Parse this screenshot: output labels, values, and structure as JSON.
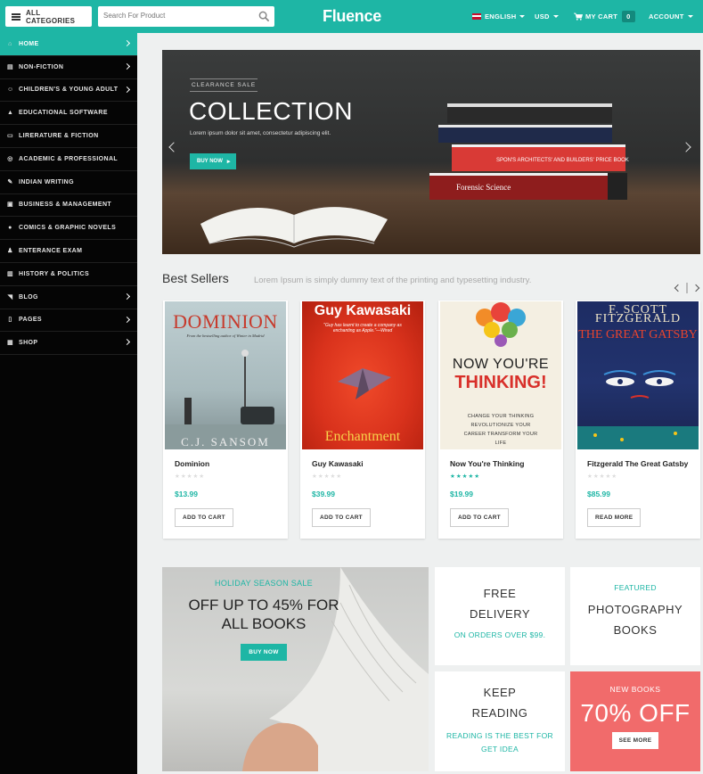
{
  "header": {
    "all_categories": "ALL CATEGORIES",
    "search_placeholder": "Search For Product",
    "logo": "Fluence",
    "language": "ENGLISH",
    "currency": "USD",
    "cart_label": "MY CART",
    "cart_count": "0",
    "account": "ACCOUNT"
  },
  "sidebar": {
    "items": [
      {
        "label": "HOME",
        "icon": "home-icon"
      },
      {
        "label": "NON-FICTION",
        "icon": "book-icon"
      },
      {
        "label": "CHILDREN'S & YOUNG ADULT",
        "icon": "child-icon"
      },
      {
        "label": "EDUCATIONAL SOFTWARE",
        "icon": "mortarboard-icon"
      },
      {
        "label": "LIRERATURE & FICTION",
        "icon": "book-open-icon"
      },
      {
        "label": "ACADEMIC & PROFESSIONAL",
        "icon": "target-icon"
      },
      {
        "label": "INDIAN WRITING",
        "icon": "pen-icon"
      },
      {
        "label": "BUSINESS & MANAGEMENT",
        "icon": "briefcase-icon"
      },
      {
        "label": "COMICS & GRAPHIC NOVELS",
        "icon": "chat-icon"
      },
      {
        "label": "ENTERANCE EXAM",
        "icon": "user-icon"
      },
      {
        "label": "HISTORY & POLITICS",
        "icon": "bank-icon"
      },
      {
        "label": "BLOG",
        "icon": "rss-icon"
      },
      {
        "label": "PAGES",
        "icon": "file-icon"
      },
      {
        "label": "SHOP",
        "icon": "gift-icon"
      }
    ]
  },
  "hero": {
    "tag": "CLEARANCE SALE",
    "title": "COLLECTION",
    "subtitle": "Lorem ipsum dolor sit amet, consectetur adipiscing elit.",
    "button": "BUY NOW",
    "book_spines": [
      "Forensic Science",
      "SPON'S ARCHITECTS' AND BUILDERS' PRICE BOOK"
    ]
  },
  "bestsellers": {
    "title": "Best Sellers",
    "description": "Lorem Ipsum is simply dummy text of the printing and typesetting industry.",
    "products": [
      {
        "name": "Dominion",
        "price": "$13.99",
        "rating": 0,
        "button": "ADD TO CART",
        "cover": {
          "title": "DOMINION",
          "author": "C.J. SANSOM",
          "tagline": "From the bestselling author of Winter in Madrid"
        }
      },
      {
        "name": "Guy Kawasaki",
        "price": "$39.99",
        "rating": 0,
        "button": "ADD TO CART",
        "cover": {
          "title": "Guy Kawasaki",
          "quote": "\"Guy has learnt to create a company as enchanting as Apple.\"—Wired",
          "bottom": "Enchantment"
        }
      },
      {
        "name": "Now You're Thinking",
        "price": "$19.99",
        "rating": 5,
        "button": "ADD TO CART",
        "cover": {
          "line1": "NOW YOU'RE",
          "line2": "THINKING!",
          "tagline": "CHANGE YOUR THINKING REVOLUTIONIZE YOUR CAREER TRANSFORM YOUR LIFE"
        }
      },
      {
        "name": "Fitzgerald The Great Gatsby",
        "price": "$85.99",
        "rating": 0,
        "button": "READ MORE",
        "cover": {
          "author1": "F. SCOTT",
          "author2": "FITZGERALD",
          "title": "THE GREAT GATSBY"
        }
      }
    ]
  },
  "promos": {
    "main": {
      "label": "HOLIDAY SEASON SALE",
      "line1": "OFF UP TO 45% FOR",
      "line2": "ALL BOOKS",
      "button": "BUY NOW"
    },
    "delivery": {
      "line1": "FREE",
      "line2": "DELIVERY",
      "sub": "ON ORDERS OVER $99."
    },
    "featured": {
      "label": "FEATURED",
      "line1": "PHOTOGRAPHY",
      "line2": "BOOKS"
    },
    "reading": {
      "line1": "KEEP",
      "line2": "READING",
      "sub1": "READING IS THE BEST FOR",
      "sub2": "GET IDEA"
    },
    "sale": {
      "label": "NEW BOOKS",
      "value": "70% OFF",
      "button": "SEE MORE"
    }
  },
  "colors": {
    "accent": "#1eb6a5",
    "sale": "#f16b6b",
    "sidebar": "#050505"
  }
}
